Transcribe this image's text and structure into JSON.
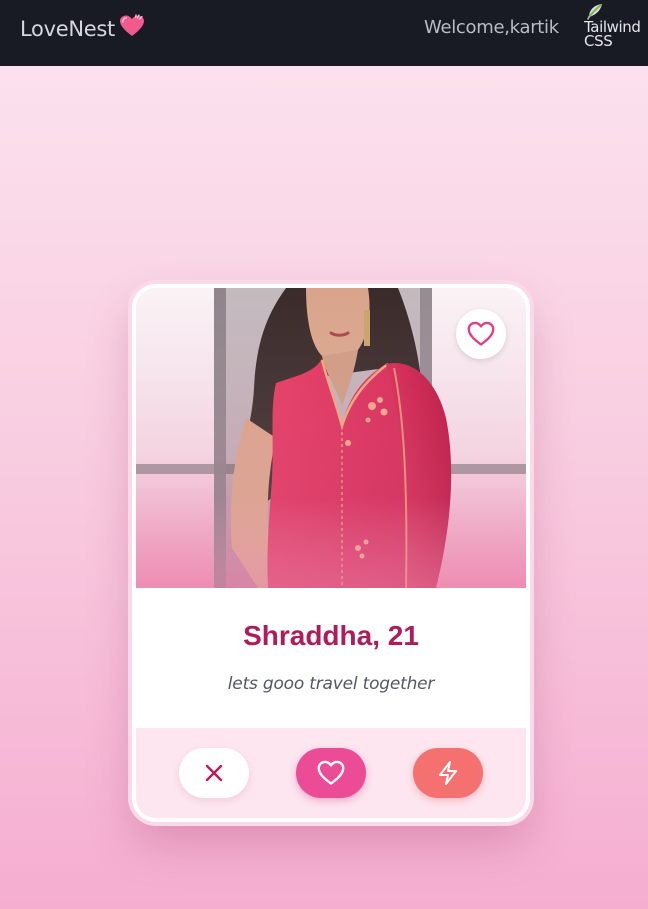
{
  "navbar": {
    "brand": "LoveNest",
    "brand_icon": "heart-emoji-icon",
    "welcome": "Welcome,kartik",
    "logo_alt": "Tailwind CSS"
  },
  "profile": {
    "name_age": "Shraddha, 21",
    "bio": "lets gooo travel together",
    "favorite_icon": "heart-outline-icon"
  },
  "actions": {
    "pass_icon": "x-icon",
    "like_icon": "heart-outline-icon",
    "super_icon": "lightning-bolt-icon"
  },
  "colors": {
    "navbar_bg": "#181b24",
    "accent_name": "#b01c5a",
    "like_button": "#ec4c96",
    "super_button": "#f4716f",
    "pass_icon": "#c0185a"
  }
}
